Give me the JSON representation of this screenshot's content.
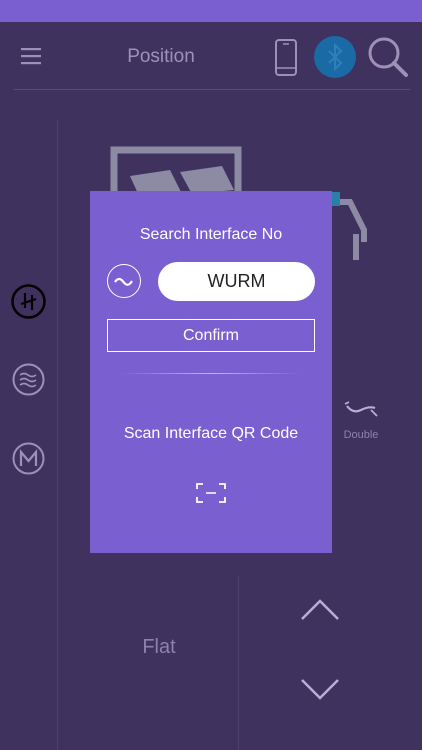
{
  "header": {
    "title": "Position",
    "menu_icon": "menu-icon",
    "phone_icon": "phone-icon",
    "bluetooth_icon": "bluetooth-icon",
    "search_icon": "search-icon",
    "bluetooth_color": "#1a6aa6"
  },
  "sidebar": {
    "icons": [
      "power-icon",
      "wave-icon",
      "m-icon"
    ]
  },
  "main": {
    "mode_label": "Double",
    "flat_label": "Flat"
  },
  "dialog": {
    "title": "Search Interface No",
    "code_value": "WURM",
    "confirm_label": "Confirm",
    "scan_label": "Scan Interface QR Code",
    "background": "#7a5fd0"
  },
  "colors": {
    "background": "#40325f",
    "accent": "#7a5fd0"
  }
}
